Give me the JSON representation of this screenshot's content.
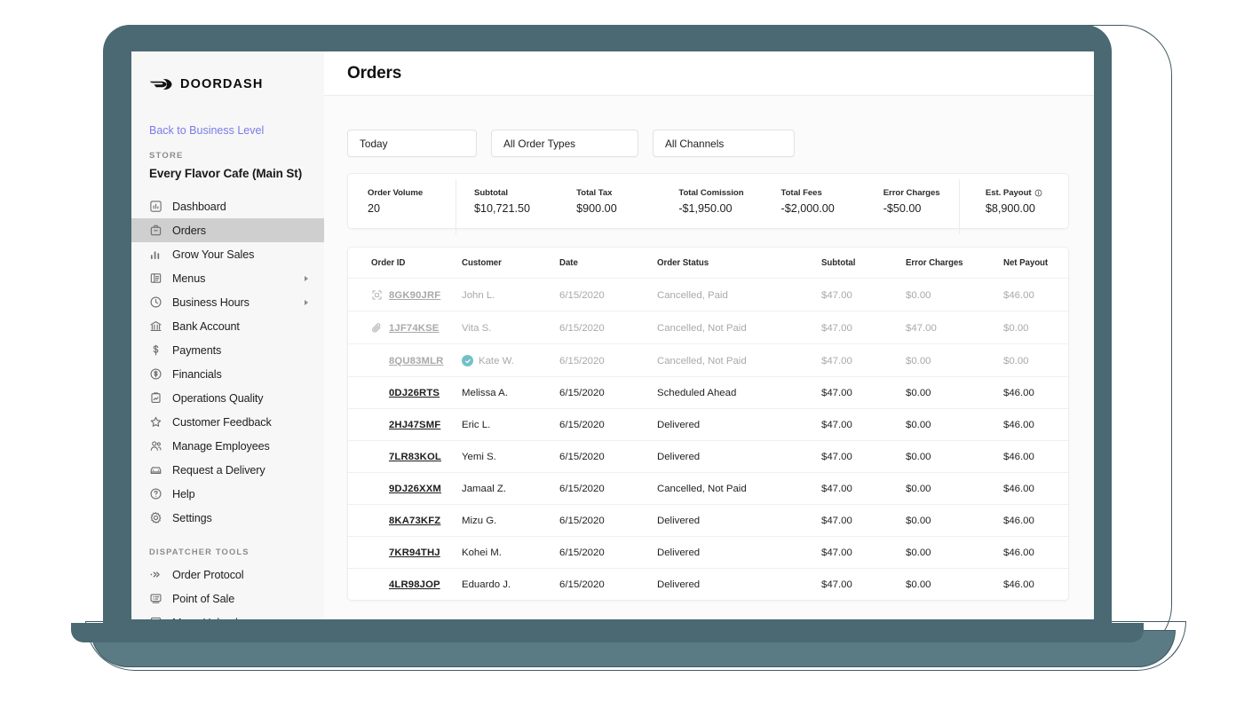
{
  "brand": {
    "name": "DOORDASH",
    "logo_icon": "doordash-chevron-logo"
  },
  "sidebar": {
    "back_link": "Back to Business Level",
    "store_section_label": "STORE",
    "store_name": "Every Flavor Cafe (Main St)",
    "items": [
      {
        "label": "Dashboard",
        "icon": "chart-bar-box-icon",
        "active": false,
        "caret": false
      },
      {
        "label": "Orders",
        "icon": "bag-icon",
        "active": true,
        "caret": false
      },
      {
        "label": "Grow Your Sales",
        "icon": "bar-chart-icon",
        "active": false,
        "caret": false
      },
      {
        "label": "Menus",
        "icon": "menu-book-icon",
        "active": false,
        "caret": true
      },
      {
        "label": "Business Hours",
        "icon": "clock-icon",
        "active": false,
        "caret": true
      },
      {
        "label": "Bank Account",
        "icon": "bank-icon",
        "active": false,
        "caret": false
      },
      {
        "label": "Payments",
        "icon": "dollar-sign-icon",
        "active": false,
        "caret": false
      },
      {
        "label": "Financials",
        "icon": "dollar-circle-icon",
        "active": false,
        "caret": false
      },
      {
        "label": "Operations Quality",
        "icon": "clipboard-chart-icon",
        "active": false,
        "caret": false
      },
      {
        "label": "Customer Feedback",
        "icon": "star-icon",
        "active": false,
        "caret": false
      },
      {
        "label": "Manage Employees",
        "icon": "people-icon",
        "active": false,
        "caret": false
      },
      {
        "label": "Request a Delivery",
        "icon": "car-icon",
        "active": false,
        "caret": false
      },
      {
        "label": "Help",
        "icon": "question-circle-icon",
        "active": false,
        "caret": false
      },
      {
        "label": "Settings",
        "icon": "gear-icon",
        "active": false,
        "caret": false
      }
    ],
    "dispatcher_section_label": "DISPATCHER TOOLS",
    "dispatcher_items": [
      {
        "label": "Order Protocol",
        "icon": "chevrons-right-icon"
      },
      {
        "label": "Point of Sale",
        "icon": "pos-terminal-icon"
      },
      {
        "label": "Menu Upload",
        "icon": "upload-icon"
      }
    ]
  },
  "header": {
    "title": "Orders"
  },
  "filters": [
    {
      "name": "date-range",
      "value": "Today"
    },
    {
      "name": "order-type",
      "value": "All Order Types"
    },
    {
      "name": "channel",
      "value": "All Channels"
    }
  ],
  "stats": [
    {
      "key": "Order Volume",
      "value": "20",
      "info": false
    },
    {
      "key": "Subtotal",
      "value": "$10,721.50",
      "info": false
    },
    {
      "key": "Total Tax",
      "value": "$900.00",
      "info": false
    },
    {
      "key": "Total Comission",
      "value": "-$1,950.00",
      "info": false
    },
    {
      "key": "Total Fees",
      "value": "-$2,000.00",
      "info": false
    },
    {
      "key": "Error Charges",
      "value": "-$50.00",
      "info": false
    },
    {
      "key": "Est. Payout",
      "value": "$8,900.00",
      "info": true
    }
  ],
  "table": {
    "columns": [
      "Order ID",
      "Customer",
      "Date",
      "Order Status",
      "Subtotal",
      "Error Charges",
      "Net Payout"
    ],
    "rows": [
      {
        "id": "8GK90JRF",
        "icon": "scan-frame-icon",
        "customer": "John L.",
        "verified": false,
        "date": "6/15/2020",
        "status": "Cancelled, Paid",
        "subtotal": "$47.00",
        "error_charges": "$0.00",
        "net_payout": "$46.00",
        "muted": true
      },
      {
        "id": "1JF74KSE",
        "icon": "paperclip-icon",
        "customer": "Vita S.",
        "verified": false,
        "date": "6/15/2020",
        "status": "Cancelled, Not Paid",
        "subtotal": "$47.00",
        "error_charges": "$47.00",
        "net_payout": "$0.00",
        "muted": true
      },
      {
        "id": "8QU83MLR",
        "icon": "",
        "customer": "Kate W.",
        "verified": true,
        "date": "6/15/2020",
        "status": "Cancelled, Not Paid",
        "subtotal": "$47.00",
        "error_charges": "$0.00",
        "net_payout": "$0.00",
        "muted": true
      },
      {
        "id": "0DJ26RTS",
        "icon": "",
        "customer": "Melissa A.",
        "verified": false,
        "date": "6/15/2020",
        "status": "Scheduled Ahead",
        "subtotal": "$47.00",
        "error_charges": "$0.00",
        "net_payout": "$46.00",
        "muted": false
      },
      {
        "id": "2HJ47SMF",
        "icon": "",
        "customer": "Eric L.",
        "verified": false,
        "date": "6/15/2020",
        "status": "Delivered",
        "subtotal": "$47.00",
        "error_charges": "$0.00",
        "net_payout": "$46.00",
        "muted": false
      },
      {
        "id": "7LR83KOL",
        "icon": "",
        "customer": "Yemi S.",
        "verified": false,
        "date": "6/15/2020",
        "status": "Delivered",
        "subtotal": "$47.00",
        "error_charges": "$0.00",
        "net_payout": "$46.00",
        "muted": false
      },
      {
        "id": "9DJ26XXM",
        "icon": "",
        "customer": "Jamaal Z.",
        "verified": false,
        "date": "6/15/2020",
        "status": "Cancelled, Not Paid",
        "subtotal": "$47.00",
        "error_charges": "$0.00",
        "net_payout": "$46.00",
        "muted": false
      },
      {
        "id": "8KA73KFZ",
        "icon": "",
        "customer": "Mizu G.",
        "verified": false,
        "date": "6/15/2020",
        "status": "Delivered",
        "subtotal": "$47.00",
        "error_charges": "$0.00",
        "net_payout": "$46.00",
        "muted": false
      },
      {
        "id": "7KR94THJ",
        "icon": "",
        "customer": "Kohei M.",
        "verified": false,
        "date": "6/15/2020",
        "status": "Delivered",
        "subtotal": "$47.00",
        "error_charges": "$0.00",
        "net_payout": "$46.00",
        "muted": false
      },
      {
        "id": "4LR98JOP",
        "icon": "",
        "customer": "Eduardo J.",
        "verified": false,
        "date": "6/15/2020",
        "status": "Delivered",
        "subtotal": "$47.00",
        "error_charges": "$0.00",
        "net_payout": "$46.00",
        "muted": false
      }
    ]
  },
  "colors": {
    "device_frame": "#4a6973",
    "device_base": "#5a7a84",
    "link": "#7a7be8",
    "active_nav": "#cfcfcf",
    "verified_badge": "#72c1c6"
  }
}
